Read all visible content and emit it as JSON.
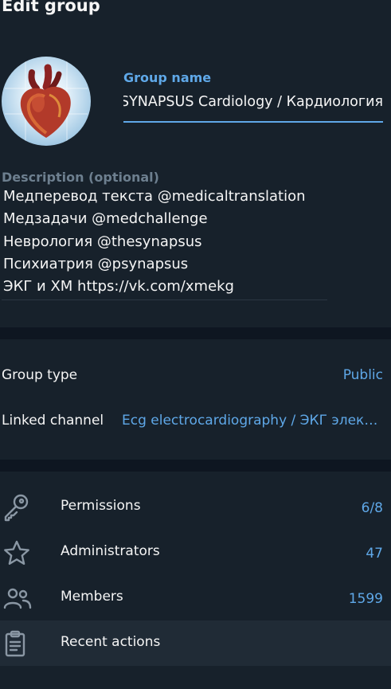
{
  "header": {
    "title": "Edit group"
  },
  "group": {
    "name_label": "Group name",
    "name_value": "SYNAPSUS Cardiology / Кардиология",
    "description_label": "Description (optional)",
    "description_lines": [
      "Медперевод текста @medicaltranslation",
      "Медзадачи @medchallenge",
      "Неврология @thesynapsus",
      "Психиатрия @psynapsus",
      "ЭКГ и ХМ https://vk.com/xmekg"
    ]
  },
  "settings": {
    "group_type_label": "Group type",
    "group_type_value": "Public",
    "linked_channel_label": "Linked channel",
    "linked_channel_value": "Ecg electrocardiography / ЭКГ электрокардиография"
  },
  "menu": {
    "permissions_label": "Permissions",
    "permissions_value": "6/8",
    "administrators_label": "Administrators",
    "administrators_value": "47",
    "members_label": "Members",
    "members_value": "1599",
    "recent_actions_label": "Recent actions",
    "icons": [
      "key-icon",
      "star-icon",
      "members-icon",
      "clipboard-icon"
    ]
  },
  "colors": {
    "background": "#17212b",
    "separator": "#0e1621",
    "accent": "#5fa8e8",
    "muted": "#6d7f8f"
  }
}
